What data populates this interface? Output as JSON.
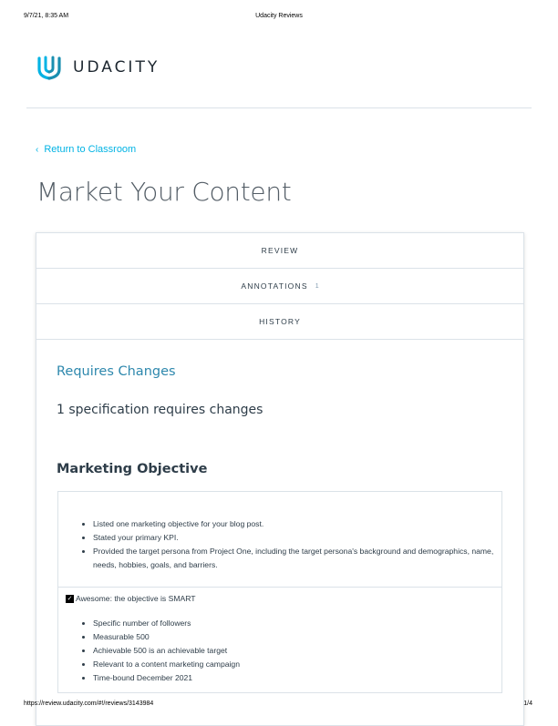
{
  "print_header": {
    "datetime": "9/7/21, 8:35 AM",
    "title": "Udacity Reviews"
  },
  "print_footer": {
    "url": "https://review.udacity.com/#!/reviews/3143984",
    "page": "1/4"
  },
  "brand": {
    "logo_text": "UDACITY",
    "accent_color": "#02b3e4"
  },
  "nav": {
    "back_label": "Return to Classroom"
  },
  "page": {
    "title": "Market Your Content"
  },
  "tabs": [
    {
      "label": "REVIEW",
      "badge": ""
    },
    {
      "label": "ANNOTATIONS",
      "badge": "1"
    },
    {
      "label": "HISTORY",
      "badge": ""
    }
  ],
  "review": {
    "status": "Requires Changes",
    "summary": "1 specification requires changes",
    "status_color": "#2e88ad"
  },
  "section": {
    "title": "Marketing Objective",
    "criteria": [
      "Listed one marketing objective for your blog post.",
      "Stated your primary KPI.",
      "Provided the target persona from Project One, including the target persona's background and demographics, name, needs, hobbies, goals, and barriers."
    ],
    "feedback_label": "Awesome: the objective is SMART",
    "feedback_checked": true,
    "smart_points": [
      "Specific number of followers",
      "Measurable 500",
      "Achievable 500 is an achievable target",
      "Relevant to a content marketing campaign",
      "Time-bound December 2021"
    ]
  }
}
